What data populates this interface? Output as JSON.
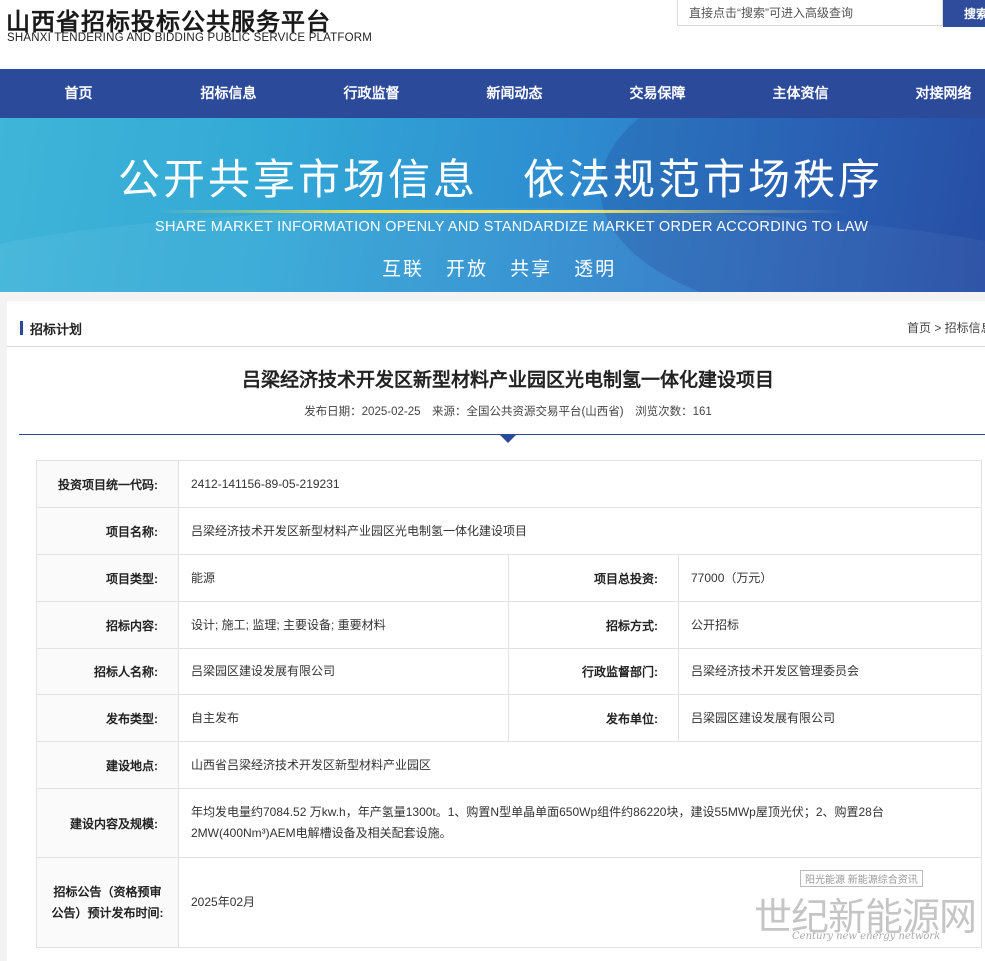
{
  "header": {
    "logo_cn": "山西省招标投标公共服务平台",
    "logo_en": "SHANXI TENDERING AND BIDDING PUBLIC SERVICE PLATFORM",
    "search_placeholder": "直接点击“搜索”可进入高级查询",
    "search_button": "搜索"
  },
  "nav": {
    "items": [
      "首页",
      "招标信息",
      "行政监督",
      "新闻动态",
      "交易保障",
      "主体资信",
      "对接网络"
    ]
  },
  "banner": {
    "headline": "公开共享市场信息　依法规范市场秩序",
    "english": "SHARE MARKET INFORMATION OPENLY AND STANDARDIZE MARKET ORDER ACCORDING TO LAW",
    "sub": "互联 开放 共享 透明"
  },
  "breadcrumb": {
    "section": "招标计划",
    "path": "首页 > 招标信息"
  },
  "article": {
    "title": "吕梁经济技术开发区新型材料产业园区光电制氢一体化建设项目",
    "meta": "发布日期：2025-02-25　来源：全国公共资源交易平台(山西省)　浏览次数：161"
  },
  "table": {
    "code_label": "投资项目统一代码:",
    "code_value": "2412-141156-89-05-219231",
    "name_label": "项目名称:",
    "name_value": "吕梁经济技术开发区新型材料产业园区光电制氢一体化建设项目",
    "type_label": "项目类型:",
    "type_value": "能源",
    "investment_label": "项目总投资:",
    "investment_value": "77000（万元）",
    "content_label": "招标内容:",
    "content_value": "设计; 施工; 监理; 主要设备; 重要材料",
    "method_label": "招标方式:",
    "method_value": "公开招标",
    "tenderer_label": "招标人名称:",
    "tenderer_value": "吕梁园区建设发展有限公司",
    "supervisor_label": "行政监督部门:",
    "supervisor_value": "吕梁经济技术开发区管理委员会",
    "pubtype_label": "发布类型:",
    "pubtype_value": "自主发布",
    "publisher_label": "发布单位:",
    "publisher_value": "吕梁园区建设发展有限公司",
    "location_label": "建设地点:",
    "location_value": "山西省吕梁经济技术开发区新型材料产业园区",
    "scale_label": "建设内容及规模:",
    "scale_value": "年均发电量约7084.52 万kw.h，年产氢量1300t。1、购置N型单晶单面650Wp组件约86220块，建设55MWp屋顶光伏；2、购置28台2MW(400Nm³)AEM电解槽设备及相关配套设施。",
    "notice_label": "招标公告（资格预审公告）预计发布时间:",
    "notice_value": "2025年02月"
  },
  "watermark": {
    "top": "阳光能源 新能源综合资讯",
    "main": "世纪新能源网",
    "en": "Century new energy network"
  }
}
